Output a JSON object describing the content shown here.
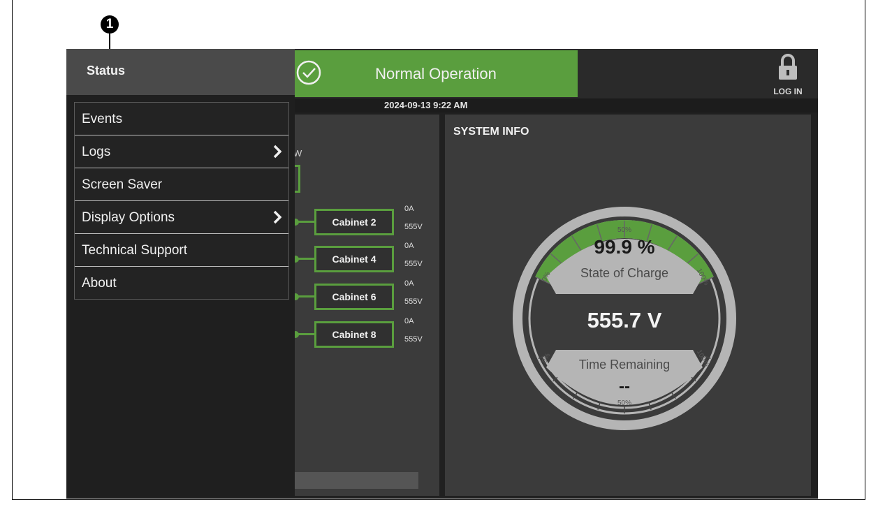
{
  "callout": {
    "number": "1"
  },
  "header": {
    "menu_title": "Status",
    "status_banner": "Normal Operation",
    "login_label": "LOG IN",
    "datetime": "2024-09-13 9:22 AM"
  },
  "menu": {
    "items": [
      {
        "label": "Events",
        "has_submenu": false
      },
      {
        "label": "Logs",
        "has_submenu": true
      },
      {
        "label": "Screen Saver",
        "has_submenu": false
      },
      {
        "label": "Display Options",
        "has_submenu": true
      },
      {
        "label": "Technical Support",
        "has_submenu": false
      },
      {
        "label": "About",
        "has_submenu": false
      }
    ]
  },
  "cabinet_panel": {
    "fragment_label": "W",
    "cabinets": [
      {
        "name": "Cabinet 2",
        "current": "0A",
        "voltage": "555V"
      },
      {
        "name": "Cabinet 4",
        "current": "0A",
        "voltage": "555V"
      },
      {
        "name": "Cabinet 6",
        "current": "0A",
        "voltage": "555V"
      },
      {
        "name": "Cabinet 8",
        "current": "0A",
        "voltage": "555V"
      }
    ]
  },
  "system_info": {
    "title": "SYSTEM INFO",
    "state_of_charge": "99.9 %",
    "state_of_charge_label": "State of Charge",
    "voltage": "555.7 V",
    "time_remaining_label": "Time Remaining",
    "time_remaining": "--",
    "gauge_top_labels": [
      "0%",
      "50%",
      "100%"
    ],
    "gauge_bottom_labels": [
      "0%",
      "50%",
      "100%"
    ],
    "state_of_charge_fraction": 0.999
  },
  "colors": {
    "accent_green": "#5a9e3e",
    "panel_bg": "#3b3b3b",
    "menu_bg": "#1f1f1f",
    "gauge_gray": "#b5b5b5"
  }
}
